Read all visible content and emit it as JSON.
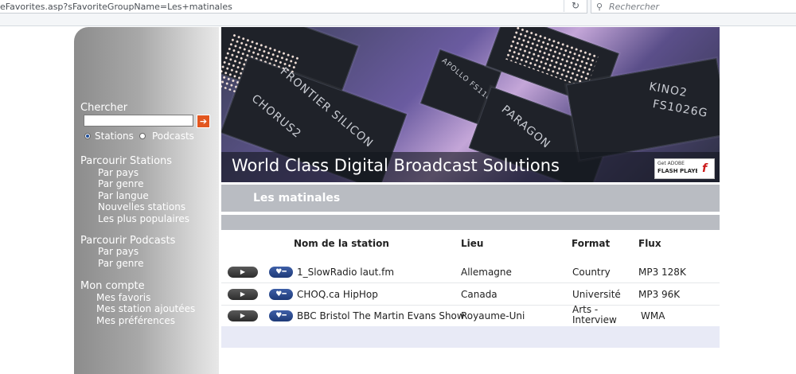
{
  "browser": {
    "url": "eFavorites.asp?sFavoriteGroupName=Les+matinales",
    "search_placeholder": "Rechercher"
  },
  "sidebar": {
    "search_title": "Chercher",
    "search_go": "➔",
    "radio_stations": "Stations",
    "radio_podcasts": "Podcasts",
    "browse_stations_title": "Parcourir Stations",
    "browse_stations_links": [
      "Par pays",
      "Par genre",
      "Par langue",
      "Nouvelles stations",
      "Les plus populaires"
    ],
    "browse_podcasts_title": "Parcourir Podcasts",
    "browse_podcasts_links": [
      "Par pays",
      "Par genre"
    ],
    "account_title": "Mon compte",
    "account_links": [
      "Mes favoris",
      "Mes station ajoutées",
      "Mes préférences"
    ]
  },
  "banner": {
    "title": "World Class Digital Broadcast Solutions",
    "chip_labels": [
      "FRONTIER SILICON",
      "CHORUS2",
      "FS1026",
      "APOLLO FS1106",
      "KINO2",
      "FS1026G",
      "PARAGON"
    ],
    "flash_get": "Get ADOBE",
    "flash_player": "FLASH PLAYER",
    "flash_logo": "f"
  },
  "section": {
    "title": "Les matinales"
  },
  "table": {
    "headers": {
      "station": "Nom de la station",
      "lieu": "Lieu",
      "format": "Format",
      "flux": "Flux"
    },
    "rows": [
      {
        "station": "1_SlowRadio laut.fm",
        "lieu": "Allemagne",
        "format": "Country",
        "flux": "MP3 128K"
      },
      {
        "station": "CHOQ.ca HipHop",
        "lieu": "Canada",
        "format": "Université",
        "flux": "MP3 96K"
      },
      {
        "station": "BBC Bristol The Martin Evans Show",
        "lieu": "Royaume-Uni",
        "format": "Arts - Interview",
        "format_line1": "Arts -",
        "format_line2": "Interview",
        "flux": "WMA"
      }
    ],
    "play_icon": "▶",
    "fav_icon": "♥━"
  }
}
